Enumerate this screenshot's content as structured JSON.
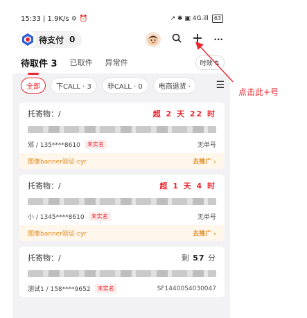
{
  "status_bar": {
    "left": "15:33 | 1.9K/s ✡ ⏰",
    "right_icons": "↗ ✱ ▣ 4G.ill",
    "battery": "63"
  },
  "header": {
    "status_label": "待支付",
    "status_count": "0",
    "search_icon": "⌕",
    "plus_icon": "+",
    "more_icon": "···"
  },
  "tabs": [
    {
      "label": "待取件 3"
    },
    {
      "label": "已取件"
    },
    {
      "label": "异常件"
    }
  ],
  "sort_label": "时效 ⇅",
  "filters": [
    {
      "label": "全部"
    },
    {
      "label": "下CALL · 3"
    },
    {
      "label": "非CALL · 0"
    },
    {
      "label": "电商退货 ·"
    }
  ],
  "menu_icon": "☰",
  "cards": [
    {
      "sender": "托寄物：/",
      "timer": "超 2 天 22 时",
      "timer_style": "red",
      "contact": "邠 / 135****8610",
      "tag": "未实名",
      "order": "无单号",
      "promo": "图像banner验证-cyr",
      "promo_link": "去推广 ›"
    },
    {
      "sender": "托寄物：/",
      "timer": "超 1 天 4 时",
      "timer_style": "red",
      "contact": "小 / 1345****8610",
      "tag": "未实名",
      "order": "无单号",
      "promo": "图像banner验证-cyr",
      "promo_link": "去推广 ›"
    },
    {
      "sender": "托寄物：/",
      "timer_prefix": "剩",
      "timer_value": "57",
      "timer_unit": "分",
      "timer_style": "grey",
      "contact": "测试1 / 158****9652",
      "tag": "未实名",
      "order": "SF1440054030047"
    }
  ],
  "annotation": "点击此+号",
  "colors": {
    "accent": "#e8262f",
    "promo": "#e08a1d"
  }
}
